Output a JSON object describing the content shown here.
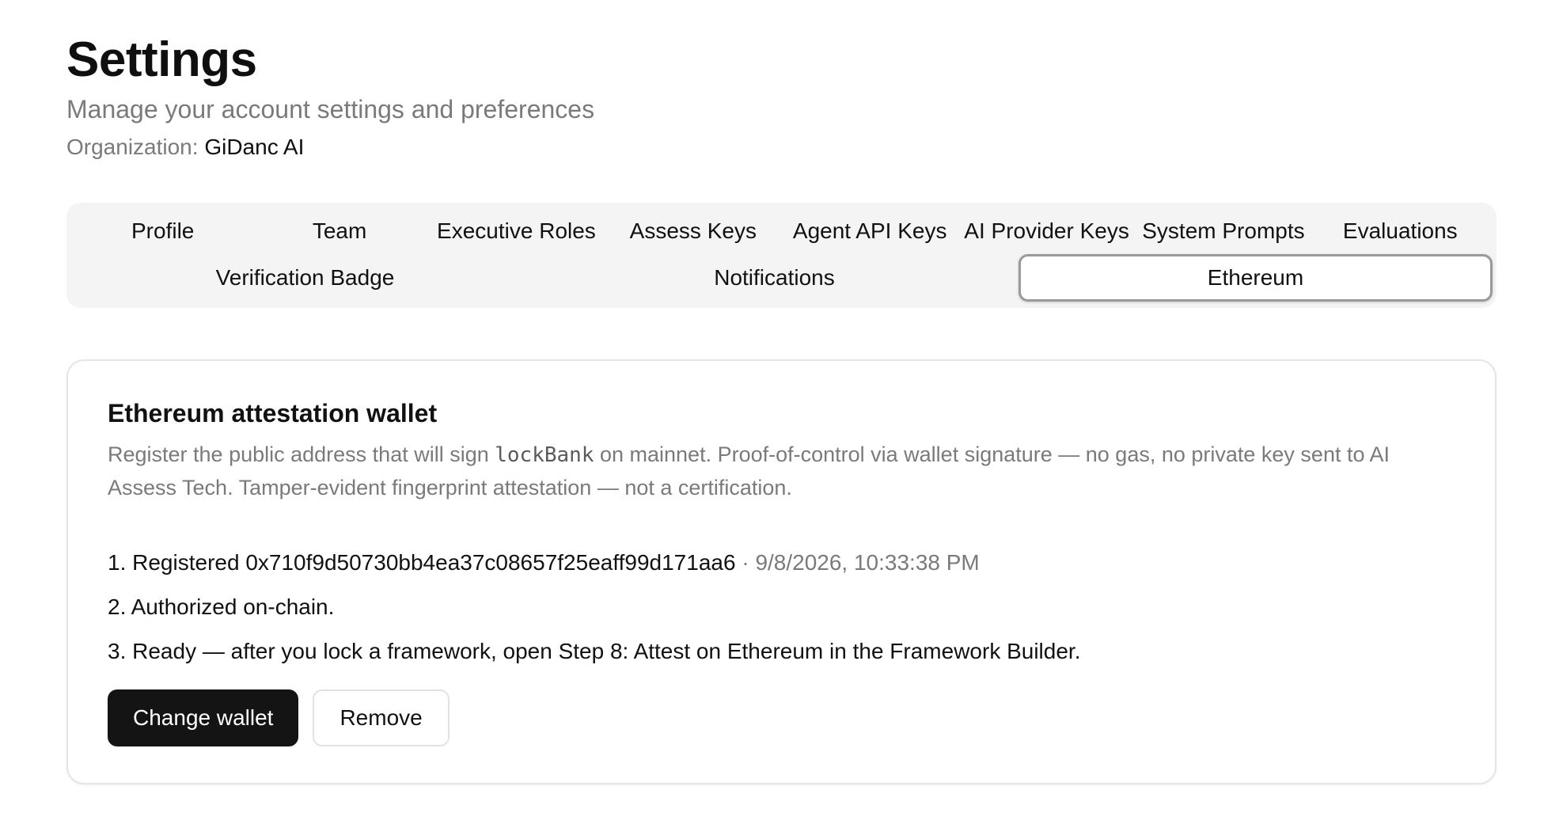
{
  "header": {
    "title": "Settings",
    "subtitle": "Manage your account settings and preferences",
    "org_label": "Organization:",
    "org_name": "GiDanc AI"
  },
  "tabs": {
    "row1": [
      "Profile",
      "Team",
      "Executive Roles",
      "Assess Keys",
      "Agent API Keys",
      "AI Provider Keys",
      "System Prompts",
      "Evaluations"
    ],
    "row2": [
      "Verification Badge",
      "Notifications",
      "Ethereum"
    ],
    "active": "Ethereum"
  },
  "card": {
    "title": "Ethereum attestation wallet",
    "desc_part1": "Register the public address that will sign ",
    "desc_code": "lockBank",
    "desc_part2": " on mainnet. Proof-of-control via wallet signature — no gas, no private key sent to AI Assess Tech. Tamper-evident fingerprint attestation — not a certification.",
    "steps": {
      "step1_prefix": "1. Registered ",
      "step1_address": "0x710f9d50730bb4ea37c08657f25eaff99d171aa6",
      "step1_separator": " · ",
      "step1_timestamp": "9/8/2026, 10:33:38 PM",
      "step2": "2. Authorized on-chain.",
      "step3": "3. Ready — after you lock a framework, open Step 8: Attest on Ethereum in the Framework Builder."
    },
    "buttons": {
      "change_wallet": "Change wallet",
      "remove": "Remove"
    }
  },
  "colors": {
    "primary_button_bg": "#141414",
    "tabs_bg": "#f4f4f4",
    "muted_text": "#7a7a7a"
  }
}
